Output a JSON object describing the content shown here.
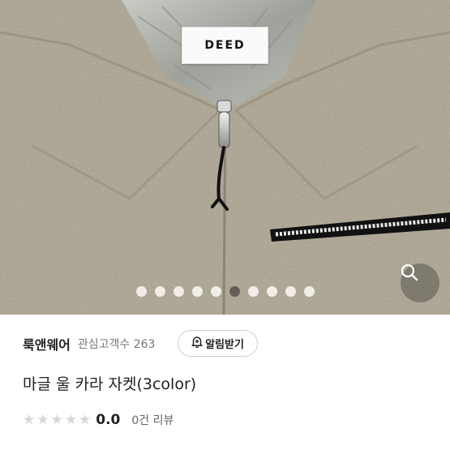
{
  "product": {
    "label_text": "DEED",
    "gallery": {
      "count": 10,
      "active_index": 5
    }
  },
  "store": {
    "name": "룩앤웨어",
    "favorites_label": "관심고객수 263",
    "notify_label": "알림받기"
  },
  "title": "마글 울 카라 자켓(3color)",
  "rating": {
    "stars_filled": 0,
    "stars_total": 5,
    "score": "0.0",
    "reviews_label": "0건 리뷰"
  },
  "icons": {
    "zoom": "search-icon",
    "notify": "bell-plus-icon",
    "star": "star-icon"
  },
  "colors": {
    "fabric": "#b7b09f",
    "lining": "#a4a89e",
    "active_dot": "#5e5a52",
    "star_empty": "#d6d6d6"
  }
}
